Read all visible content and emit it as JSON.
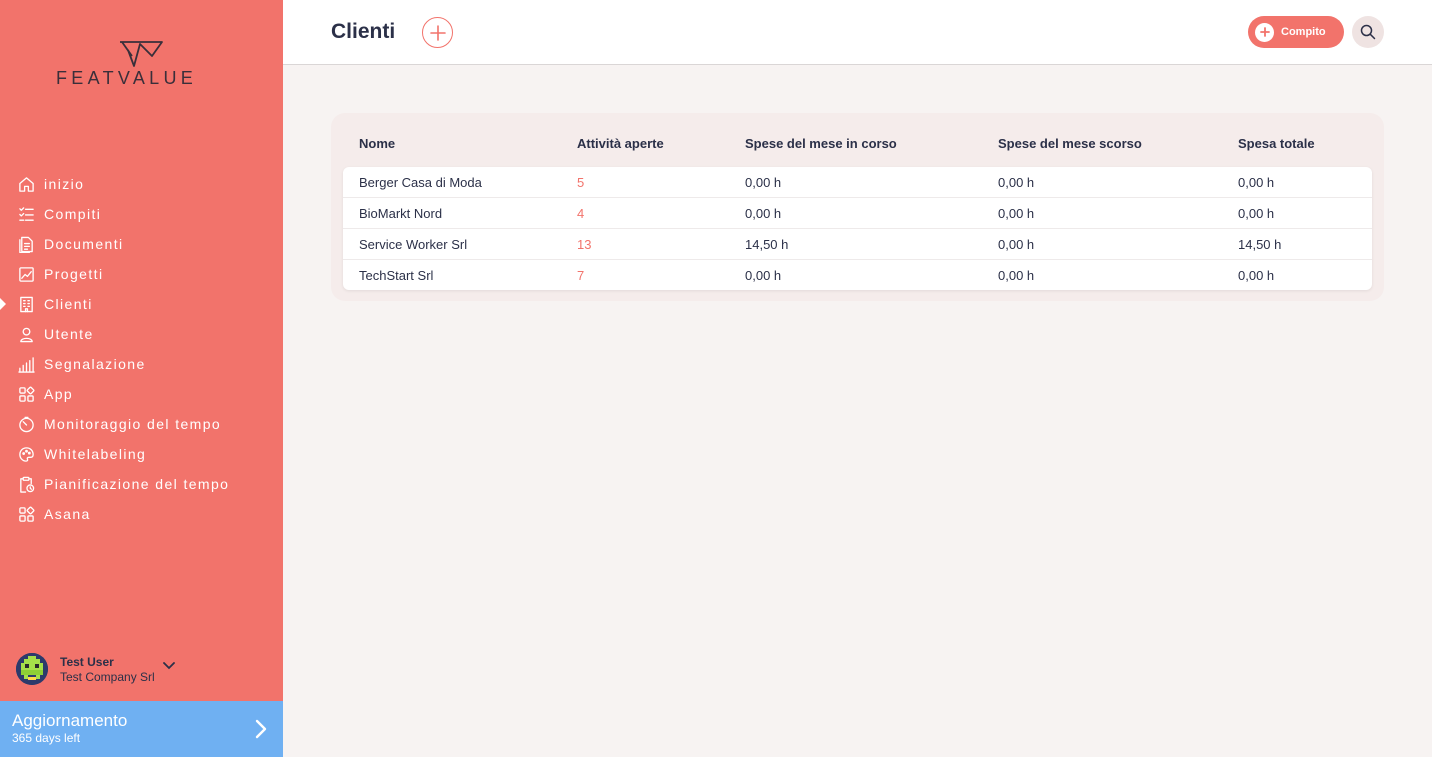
{
  "brand": {
    "name": "FEATVALUE",
    "accent": "#f2736b",
    "upgrade_color": "#6fb0f2"
  },
  "sidebar": {
    "items": [
      {
        "label": "inizio",
        "icon": "home-icon"
      },
      {
        "label": "Compiti",
        "icon": "checklist-icon"
      },
      {
        "label": "Documenti",
        "icon": "document-icon"
      },
      {
        "label": "Progetti",
        "icon": "chart-icon"
      },
      {
        "label": "Clienti",
        "icon": "building-icon",
        "active": true
      },
      {
        "label": "Utente",
        "icon": "user-icon"
      },
      {
        "label": "Segnalazione",
        "icon": "report-icon"
      },
      {
        "label": "App",
        "icon": "apps-icon"
      },
      {
        "label": "Monitoraggio del tempo",
        "icon": "timer-icon"
      },
      {
        "label": "Whitelabeling",
        "icon": "palette-icon"
      },
      {
        "label": "Pianificazione del tempo",
        "icon": "clipboard-clock-icon"
      },
      {
        "label": "Asana",
        "icon": "apps-icon"
      }
    ],
    "user": {
      "name": "Test User",
      "company": "Test Company Srl"
    },
    "upgrade": {
      "title": "Aggiornamento",
      "subtitle": "365 days left"
    }
  },
  "header": {
    "title": "Clienti",
    "task_button": "Compito"
  },
  "table": {
    "columns": [
      "Nome",
      "Attività aperte",
      "Spese del mese in corso",
      "Spese del mese scorso",
      "Spesa totale"
    ],
    "rows": [
      [
        "Berger Casa di Moda",
        "5",
        "0,00 h",
        "0,00 h",
        "0,00 h"
      ],
      [
        "BioMarkt Nord",
        "4",
        "0,00 h",
        "0,00 h",
        "0,00 h"
      ],
      [
        "Service Worker Srl",
        "13",
        "14,50 h",
        "0,00 h",
        "14,50 h"
      ],
      [
        "TechStart Srl",
        "7",
        "0,00 h",
        "0,00 h",
        "0,00 h"
      ]
    ]
  }
}
